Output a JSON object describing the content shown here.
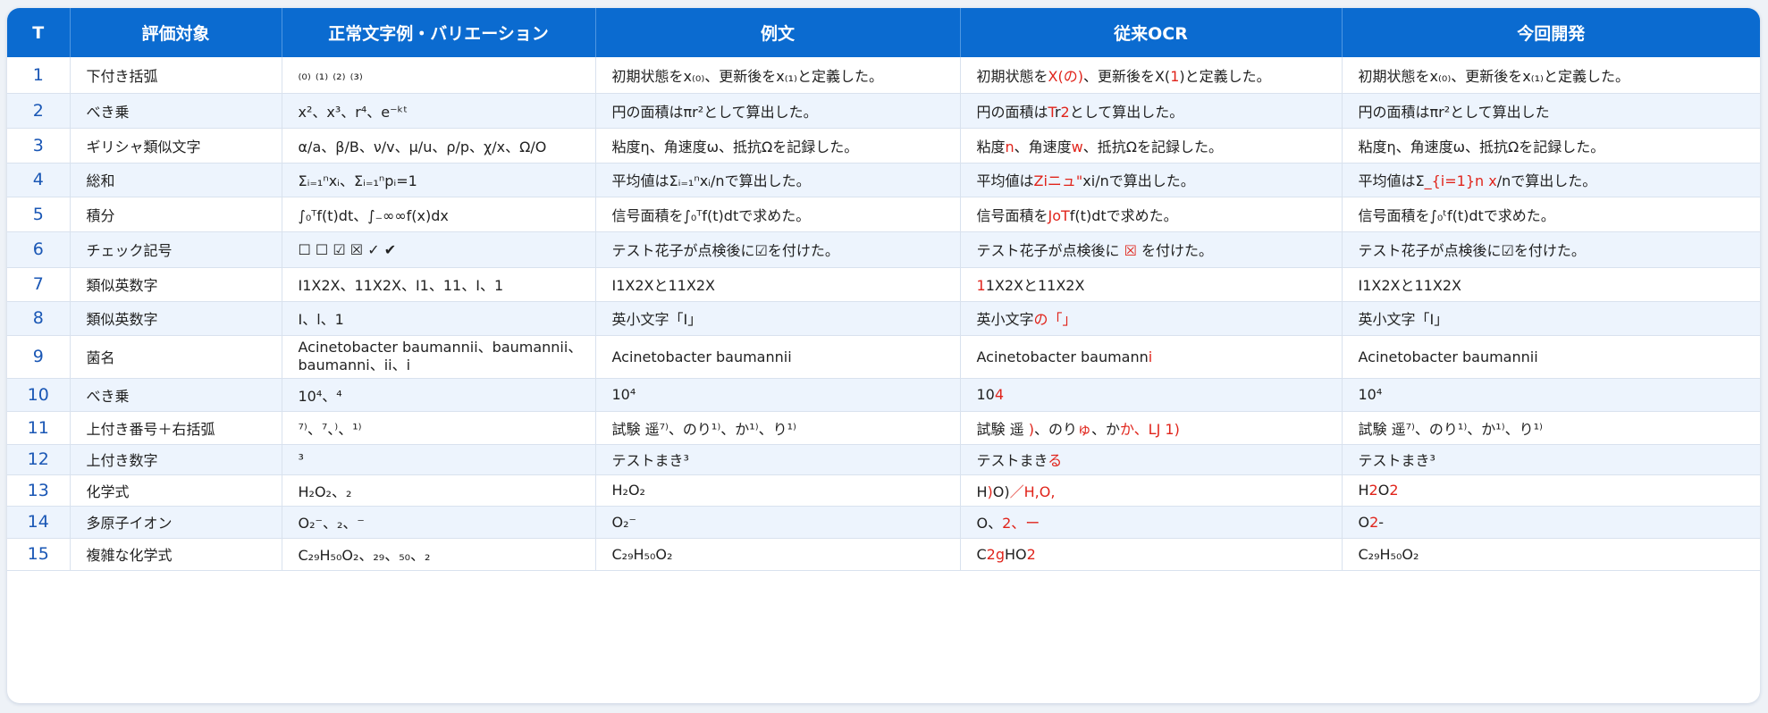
{
  "headers": [
    "T",
    "評価対象",
    "正常文字例・バリエーション",
    "例文",
    "従来OCR",
    "今回開発"
  ],
  "rows": [
    {
      "no": "1",
      "target": "下付き括弧",
      "variants": "₍₀₎ ₍₁₎ ₍₂₎ ₍₃₎",
      "example": "初期状態をx₍₀₎、更新後をx₍₁₎と定義した。",
      "ocr": [
        {
          "t": "初期状態を"
        },
        {
          "t": "X(の)",
          "r": true
        },
        {
          "t": "、更新後をX("
        },
        {
          "t": "1",
          "r": true
        },
        {
          "t": ")と定義した。"
        }
      ],
      "dev": [
        {
          "t": "初期状態をx₍₀₎、更新後をx₍₁₎と定義した。"
        }
      ]
    },
    {
      "no": "2",
      "target": "べき乗",
      "variants": "x²、x³、r⁴、e⁻ᵏᵗ",
      "example": "円の面積はπr²として算出した。",
      "ocr": [
        {
          "t": "円の面積は"
        },
        {
          "t": "T",
          "r": true
        },
        {
          "t": "r"
        },
        {
          "t": "2",
          "r": true
        },
        {
          "t": "として算出した。"
        }
      ],
      "dev": [
        {
          "t": "円の面積はπr²として算出した"
        }
      ]
    },
    {
      "no": "3",
      "target": "ギリシャ類似文字",
      "variants": "α/a、β/B、ν/v、μ/u、ρ/p、χ/x、Ω/O",
      "example": "粘度η、角速度ω、抵抗Ωを記録した。",
      "ocr": [
        {
          "t": "粘度"
        },
        {
          "t": "n",
          "r": true
        },
        {
          "t": "、角速度"
        },
        {
          "t": "w",
          "r": true
        },
        {
          "t": "、抵抗Ωを記録した。"
        }
      ],
      "dev": [
        {
          "t": "粘度η、角速度ω、抵抗Ωを記録した。"
        }
      ]
    },
    {
      "no": "4",
      "target": "総和",
      "variants": "Σᵢ₌₁ⁿxᵢ、Σᵢ₌₁ⁿpᵢ=1",
      "example": "平均値はΣᵢ₌₁ⁿxᵢ/nで算出した。",
      "ocr": [
        {
          "t": "平均値は"
        },
        {
          "t": "Ziニュ\"",
          "r": true
        },
        {
          "t": "xi/nで算出した。"
        }
      ],
      "dev": [
        {
          "t": "平均値はΣ"
        },
        {
          "t": "_{i=1}n x",
          "r": true
        },
        {
          "t": "/nで算出した。"
        }
      ]
    },
    {
      "no": "5",
      "target": "積分",
      "variants": "∫₀ᵀf(t)dt、∫₋∞∞f(x)dx",
      "example": "信号面積を∫₀ᵀf(t)dtで求めた。",
      "ocr": [
        {
          "t": "信号面積を"
        },
        {
          "t": "JoT",
          "r": true
        },
        {
          "t": "f(t)dtで求めた。"
        }
      ],
      "dev": [
        {
          "t": "信号面積を∫₀ᵗf(t)dtで求めた。"
        }
      ]
    },
    {
      "no": "6",
      "target": "チェック記号",
      "variants": "☐ ☐ ☑ ☒ ✓ ✔",
      "example": "テスト花子が点検後に☑を付けた。",
      "ocr": [
        {
          "t": "テスト花子が点検後に "
        },
        {
          "t": "☒",
          "r": true
        },
        {
          "t": " を付けた。"
        }
      ],
      "dev": [
        {
          "t": "テスト花子が点検後に☑を付けた。"
        }
      ]
    },
    {
      "no": "7",
      "target": "類似英数字",
      "variants": "I1X2X、11X2X、I1、11、I、1",
      "example": "I1X2Xと11X2X",
      "ocr": [
        {
          "t": "1",
          "r": true
        },
        {
          "t": "1X2Xと11X2X"
        }
      ],
      "dev": [
        {
          "t": "I1X2Xと11X2X"
        }
      ]
    },
    {
      "no": "8",
      "target": "類似英数字",
      "variants": "I、l、1",
      "example": "英小文字「I」",
      "ocr": [
        {
          "t": "英小文字"
        },
        {
          "t": "の「」",
          "r": true
        }
      ],
      "dev": [
        {
          "t": "英小文字「I」"
        }
      ]
    },
    {
      "no": "9",
      "target": "菌名",
      "variants": "Acinetobacter baumannii、baumannii、baumanni、ii、i",
      "example": "Acinetobacter baumannii",
      "ocr": [
        {
          "t": "Acinetobacter baumann"
        },
        {
          "t": "i",
          "r": true
        }
      ],
      "dev": [
        {
          "t": "Acinetobacter baumannii"
        }
      ]
    },
    {
      "no": "10",
      "target": "べき乗",
      "variants": "10⁴、⁴",
      "example": "10⁴",
      "ocr": [
        {
          "t": "10"
        },
        {
          "t": "4",
          "r": true
        }
      ],
      "dev": [
        {
          "t": "10⁴"
        }
      ]
    },
    {
      "no": "11",
      "target": "上付き番号＋右括弧",
      "variants": "⁷⁾、⁷、⁾、¹⁾",
      "example": "試験 遥⁷⁾、のり¹⁾、か¹⁾、り¹⁾",
      "ocr": [
        {
          "t": "試験 遥 "
        },
        {
          "t": ")",
          "r": true
        },
        {
          "t": "、のり"
        },
        {
          "t": "ゅ",
          "r": true
        },
        {
          "t": "、か"
        },
        {
          "t": "か、LJ 1)",
          "r": true
        }
      ],
      "dev": [
        {
          "t": "試験 遥⁷⁾、のり¹⁾、か¹⁾、り¹⁾"
        }
      ]
    },
    {
      "no": "12",
      "target": "上付き数字",
      "variants": "³",
      "example": "テストまき³",
      "ocr": [
        {
          "t": "テストまき"
        },
        {
          "t": "る",
          "r": true
        }
      ],
      "dev": [
        {
          "t": "テストまき³"
        }
      ]
    },
    {
      "no": "13",
      "target": "化学式",
      "variants": "H₂O₂、₂",
      "example": "H₂O₂",
      "ocr": [
        {
          "t": "H"
        },
        {
          "t": ")",
          "r": true
        },
        {
          "t": "O)"
        },
        {
          "t": "／H,O,",
          "r": true
        }
      ],
      "dev": [
        {
          "t": "H"
        },
        {
          "t": "2",
          "r": true
        },
        {
          "t": "O"
        },
        {
          "t": "2",
          "r": true
        }
      ]
    },
    {
      "no": "14",
      "target": "多原子イオン",
      "variants": "O₂⁻、₂、⁻",
      "example": "O₂⁻",
      "ocr": [
        {
          "t": "O、"
        },
        {
          "t": "2、ー",
          "r": true
        }
      ],
      "dev": [
        {
          "t": "O"
        },
        {
          "t": "2",
          "r": true
        },
        {
          "t": "-"
        }
      ]
    },
    {
      "no": "15",
      "target": "複雑な化学式",
      "variants": "C₂₉H₅₀O₂、₂₉、₅₀、₂",
      "example": "C₂₉H₅₀O₂",
      "ocr": [
        {
          "t": "C"
        },
        {
          "t": "2g",
          "r": true
        },
        {
          "t": "HO"
        },
        {
          "t": "2",
          "r": true
        }
      ],
      "dev": [
        {
          "t": "C₂₉H₅₀O₂"
        }
      ]
    }
  ]
}
